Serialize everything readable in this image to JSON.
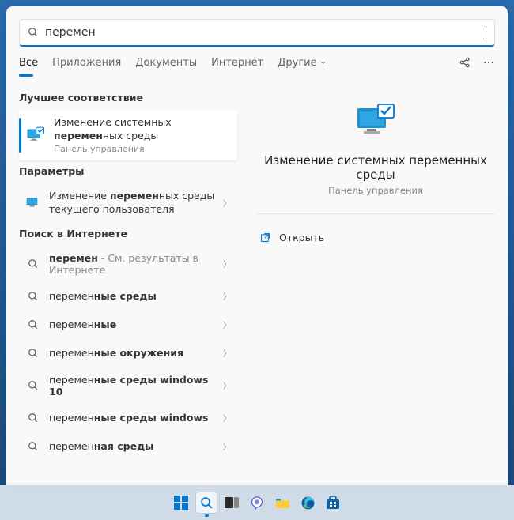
{
  "search": {
    "query": "перемен"
  },
  "tabs": {
    "all": "Все",
    "apps": "Приложения",
    "docs": "Документы",
    "web": "Интернет",
    "more": "Другие"
  },
  "sections": {
    "best": "Лучшее соответствие",
    "settings": "Параметры",
    "web": "Поиск в Интернете"
  },
  "best_match": {
    "title_pre": "Изменение системных ",
    "title_bold": "перемен",
    "title_post": "ных среды",
    "subtitle": "Панель управления"
  },
  "settings_item": {
    "pre": "Изменение ",
    "bold": "перемен",
    "post": "ных среды текущего пользователя"
  },
  "web_items": [
    {
      "bold": "перемен",
      "rest": " - См. результаты в Интернете",
      "dim": true
    },
    {
      "prefix": "перемен",
      "bold": "ные среды"
    },
    {
      "prefix": "перемен",
      "bold": "ные"
    },
    {
      "prefix": "перемен",
      "bold": "ные окружения"
    },
    {
      "prefix": "перемен",
      "bold": "ные среды windows 10"
    },
    {
      "prefix": "перемен",
      "bold": "ные среды windows"
    },
    {
      "prefix": "перемен",
      "bold": "ная среды"
    }
  ],
  "preview": {
    "title": "Изменение системных переменных среды",
    "subtitle": "Панель управления",
    "open": "Открыть"
  }
}
